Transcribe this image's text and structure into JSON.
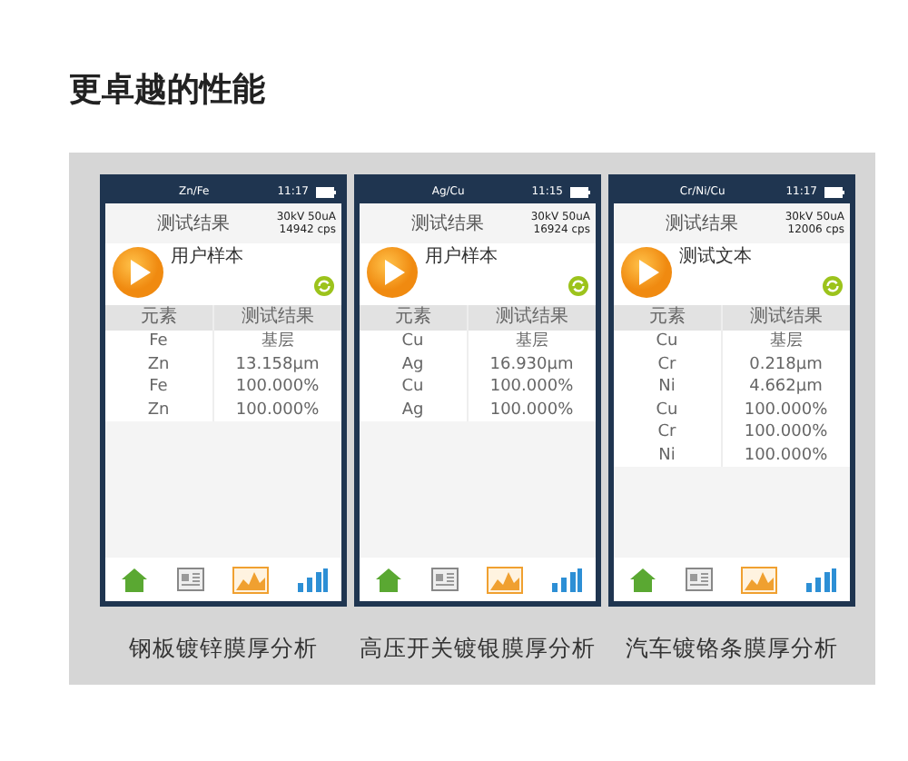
{
  "heading": "更卓越的性能",
  "phones": [
    {
      "title": "Zn/Fe",
      "time": "11:17",
      "header": "测试结果",
      "settings": "30kV 50uA",
      "counts": "14942 cps",
      "sample": "用户样本",
      "columns": [
        "元素",
        "测试结果"
      ],
      "rows": [
        [
          "Fe",
          "基层"
        ],
        [
          "Zn",
          "13.158μm"
        ],
        [
          "Fe",
          "100.000%"
        ],
        [
          "Zn",
          "100.000%"
        ]
      ],
      "caption": "钢板镀锌膜厚分析"
    },
    {
      "title": "Ag/Cu",
      "time": "11:15",
      "header": "测试结果",
      "settings": "30kV 50uA",
      "counts": "16924 cps",
      "sample": "用户样本",
      "columns": [
        "元素",
        "测试结果"
      ],
      "rows": [
        [
          "Cu",
          "基层"
        ],
        [
          "Ag",
          "16.930μm"
        ],
        [
          "Cu",
          "100.000%"
        ],
        [
          "Ag",
          "100.000%"
        ]
      ],
      "caption": "高压开关镀银膜厚分析"
    },
    {
      "title": "Cr/Ni/Cu",
      "time": "11:17",
      "header": "测试结果",
      "settings": "30kV 50uA",
      "counts": "12006 cps",
      "sample": "测试文本",
      "columns": [
        "元素",
        "测试结果"
      ],
      "rows": [
        [
          "Cu",
          "基层"
        ],
        [
          "Cr",
          "0.218μm"
        ],
        [
          "Ni",
          "4.662μm"
        ],
        [
          "Cu",
          "100.000%"
        ],
        [
          "Cr",
          "100.000%"
        ],
        [
          "Ni",
          "100.000%"
        ]
      ],
      "caption": "汽车镀铬条膜厚分析"
    }
  ]
}
